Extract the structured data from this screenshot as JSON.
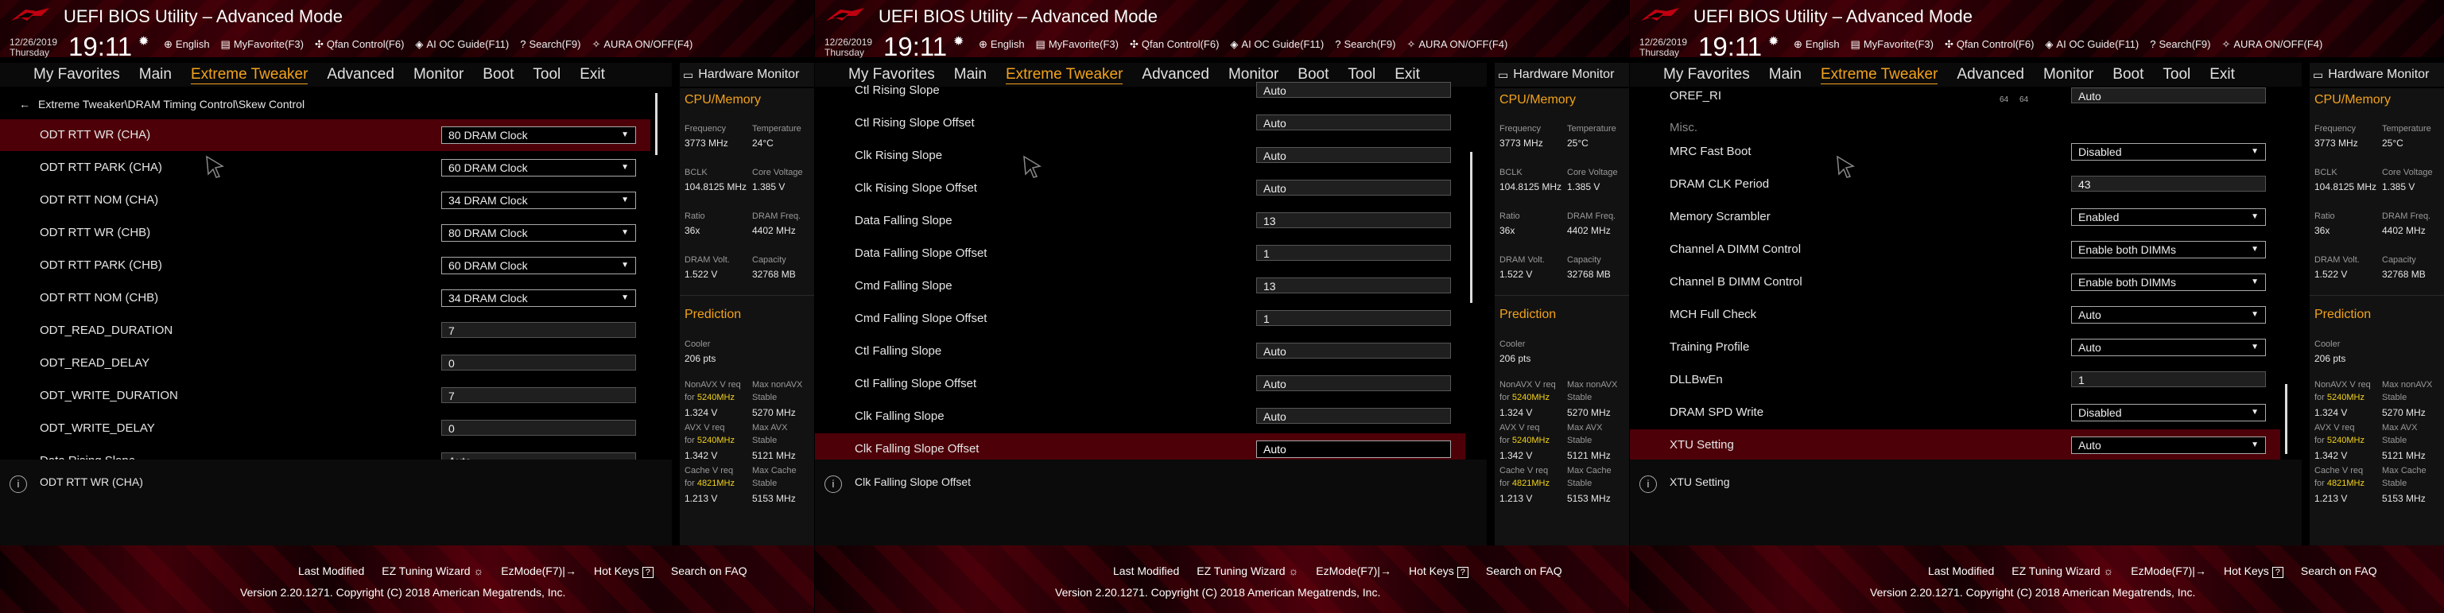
{
  "header": {
    "title": "UEFI BIOS Utility – Advanced Mode",
    "date": "12/26/2019",
    "day": "Thursday",
    "time": "19:11",
    "tools": [
      "English",
      "MyFavorite(F3)",
      "Qfan Control(F6)",
      "AI OC Guide(F11)",
      "Search(F9)",
      "AURA ON/OFF(F4)"
    ]
  },
  "menu": [
    "My Favorites",
    "Main",
    "Extreme Tweaker",
    "Advanced",
    "Monitor",
    "Boot",
    "Tool",
    "Exit"
  ],
  "hw": {
    "title": "Hardware Monitor",
    "cpu_section": "CPU/Memory",
    "frequency_label": "Frequency",
    "frequency": "3773 MHz",
    "temperature_label": "Temperature",
    "bclk_label": "BCLK",
    "bclk": "104.8125 MHz",
    "core_voltage_label": "Core Voltage",
    "core_voltage": "1.385 V",
    "ratio_label": "Ratio",
    "ratio": "36x",
    "dram_freq_label": "DRAM Freq.",
    "dram_freq": "4402 MHz",
    "dram_volt_label": "DRAM Volt.",
    "dram_volt": "1.522 V",
    "capacity_label": "Capacity",
    "capacity": "32768 MB",
    "prediction_section": "Prediction",
    "cooler_label": "Cooler",
    "cooler": "206 pts",
    "nonavx_label": "NonAVX V req",
    "for_label": "for",
    "freq1": "5240MHz",
    "nonavx_v": "1.324 V",
    "max_nonavx_label": "Max nonAVX",
    "stable_label": "Stable",
    "max_nonavx": "5270 MHz",
    "avx_label": "AVX V req",
    "avx_v": "1.342 V",
    "max_avx_label": "Max AVX",
    "max_avx": "5121 MHz",
    "cache_label": "Cache V req",
    "freq2": "4821MHz",
    "cache_v": "1.213 V",
    "max_cache_label": "Max Cache",
    "max_cache": "5153 MHz"
  },
  "temps": [
    "24°C",
    "25°C",
    "25°C"
  ],
  "footer": {
    "last_modified": "Last Modified",
    "ez_tuning": "EZ Tuning Wizard",
    "ezmode": "EzMode(F7)|→",
    "hotkeys": "Hot Keys",
    "hotkeys_key": "?",
    "faq": "Search on FAQ",
    "copyright": "Version 2.20.1271. Copyright (C) 2018 American Megatrends, Inc."
  },
  "screen1": {
    "breadcrumb": "Extreme Tweaker\\DRAM Timing Control\\Skew Control",
    "rows": [
      {
        "label": "ODT RTT WR (CHA)",
        "value": "80 DRAM Clock"
      },
      {
        "label": "ODT RTT PARK (CHA)",
        "value": "60 DRAM Clock"
      },
      {
        "label": "ODT RTT NOM (CHA)",
        "value": "34 DRAM Clock"
      },
      {
        "label": "ODT RTT WR (CHB)",
        "value": "80 DRAM Clock"
      },
      {
        "label": "ODT RTT PARK (CHB)",
        "value": "60 DRAM Clock"
      },
      {
        "label": "ODT RTT NOM (CHB)",
        "value": "34 DRAM Clock"
      },
      {
        "label": "ODT_READ_DURATION",
        "value": "7"
      },
      {
        "label": "ODT_READ_DELAY",
        "value": "0"
      },
      {
        "label": "ODT_WRITE_DURATION",
        "value": "7"
      },
      {
        "label": "ODT_WRITE_DELAY",
        "value": "0"
      },
      {
        "label": "Data Rising Slope",
        "value": "Auto"
      }
    ],
    "description": "ODT RTT WR (CHA)"
  },
  "screen2": {
    "rows": [
      {
        "label": "Ctl Rising Slope",
        "value": "Auto"
      },
      {
        "label": "Ctl Rising Slope Offset",
        "value": "Auto"
      },
      {
        "label": "Clk Rising Slope",
        "value": "Auto"
      },
      {
        "label": "Clk Rising Slope Offset",
        "value": "Auto"
      },
      {
        "label": "Data Falling Slope",
        "value": "13"
      },
      {
        "label": "Data Falling Slope Offset",
        "value": "1"
      },
      {
        "label": "Cmd Falling Slope",
        "value": "13"
      },
      {
        "label": "Cmd Falling Slope Offset",
        "value": "1"
      },
      {
        "label": "Ctl Falling Slope",
        "value": "Auto"
      },
      {
        "label": "Ctl Falling Slope Offset",
        "value": "Auto"
      },
      {
        "label": "Clk Falling Slope",
        "value": "Auto"
      },
      {
        "label": "Clk Falling Slope Offset",
        "value": "Auto"
      }
    ],
    "description": "Clk Falling Slope Offset"
  },
  "screen3": {
    "oref_label": "OREF_RI",
    "oref_small": [
      "64",
      "64"
    ],
    "oref_value": "Auto",
    "misc": "Misc.",
    "rows": [
      {
        "label": "MRC Fast Boot",
        "value": "Disabled"
      },
      {
        "label": "DRAM CLK Period",
        "value": "43"
      },
      {
        "label": "Memory Scrambler",
        "value": "Enabled"
      },
      {
        "label": "Channel A DIMM Control",
        "value": "Enable both DIMMs"
      },
      {
        "label": "Channel B DIMM Control",
        "value": "Enable both DIMMs"
      },
      {
        "label": "MCH Full Check",
        "value": "Auto"
      },
      {
        "label": "Training Profile",
        "value": "Auto"
      },
      {
        "label": "DLLBwEn",
        "value": "1"
      },
      {
        "label": "DRAM SPD Write",
        "value": "Disabled"
      },
      {
        "label": "XTU Setting",
        "value": "Auto"
      }
    ],
    "description": "XTU Setting"
  }
}
